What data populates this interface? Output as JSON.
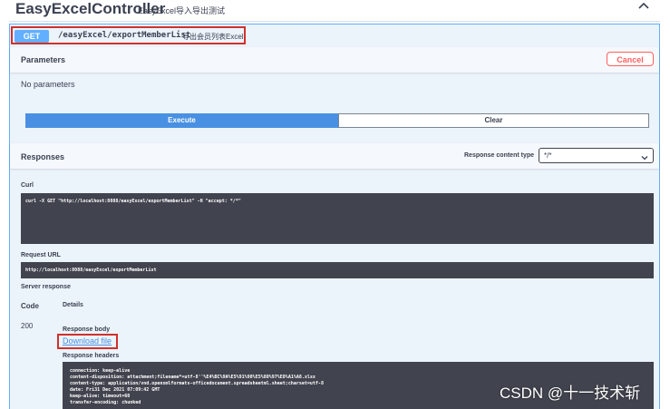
{
  "header": {
    "title": "EasyExcelController",
    "subtitle": "EasyExcel导入导出测试",
    "collapse_icon": "chevron-up-icon"
  },
  "operation": {
    "method": "GET",
    "path": "/easyExcel/exportMemberList",
    "description": "导出会员列表Excel",
    "colors": {
      "get": "#61affe",
      "highlight": "#d0312d"
    }
  },
  "parameters": {
    "heading": "Parameters",
    "cancel_label": "Cancel",
    "empty_text": "No parameters"
  },
  "actions": {
    "execute_label": "Execute",
    "clear_label": "Clear",
    "execute_color": "#4990e2"
  },
  "responses": {
    "heading": "Responses",
    "content_type_label": "Response content type",
    "content_type_value": "*/*",
    "curl_label": "Curl",
    "curl_command": "curl -X GET \"http://localhost:8088/easyExcel/exportMemberList\" -H \"accept: */*\"",
    "request_url_label": "Request URL",
    "request_url": "http://localhost:8088/easyExcel/exportMemberList",
    "server_response_label": "Server response",
    "code_col": "Code",
    "details_col": "Details",
    "status_code": "200",
    "body_label": "Response body",
    "download_label": "Download file",
    "headers_label": "Response headers",
    "headers": [
      "connection: keep-alive",
      "content-disposition: attachment;filename*=utf-8''%E4%BC%9A%E5%91%98%E5%88%97%E8%A1%A8.xlsx",
      "content-type: application/vnd.openxmlformats-officedocument.spreadsheetml.sheet;charset=utf-8",
      "date: Fri31 Dec 2021 07:09:42 GMT",
      "keep-alive: timeout=60",
      "transfer-encoding: chunked"
    ]
  },
  "watermark": "CSDN @十一技术斩"
}
